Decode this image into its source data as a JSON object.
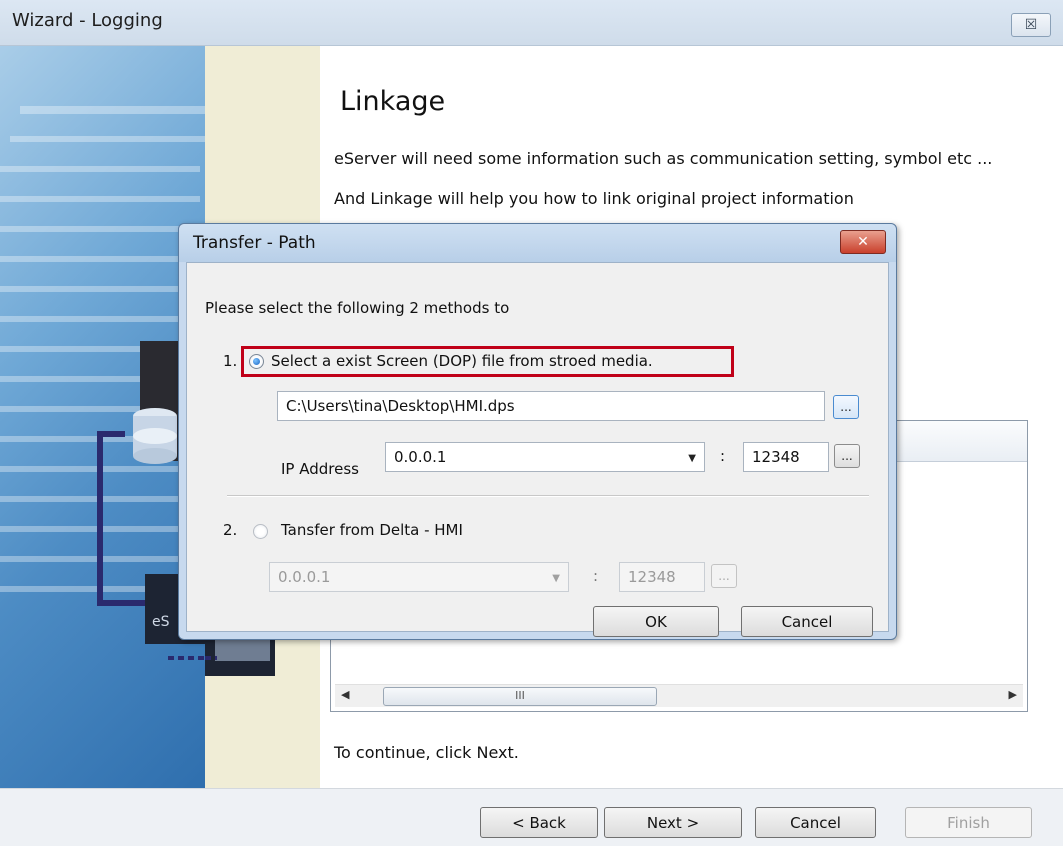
{
  "wizard": {
    "title": "Wizard - Logging",
    "close_symbol": "☒",
    "heading": "Linkage",
    "paragraph1": "eServer will need some information such as communication setting, symbol etc ...",
    "paragraph2": "And Linkage will help you how to link original project information",
    "continue_text": "To continue, click Next.",
    "scroll_thumb_glyph": "III",
    "buttons": {
      "back": "< Back",
      "next": "Next >",
      "cancel": "Cancel",
      "finish": "Finish"
    }
  },
  "dialog": {
    "title": "Transfer - Path",
    "close_symbol": "✕",
    "intro": "Please select the following 2 methods to",
    "option1": {
      "number": "1.",
      "label": "Select a exist  Screen (DOP) file from stroed media.",
      "selected": true,
      "path_value": "C:\\Users\\tina\\Desktop\\HMI.dps",
      "ip_label": "IP Address",
      "ip_value": "0.0.0.1",
      "port_value": "12348"
    },
    "option2": {
      "number": "2.",
      "label": "Tansfer from Delta - HMI",
      "selected": false,
      "ip_value": "0.0.0.1",
      "port_value": "12348"
    },
    "colon": ":",
    "ellipsis": "...",
    "ok_label": "OK",
    "cancel_label": "Cancel"
  },
  "colors": {
    "highlight_border": "#c00018",
    "dialog_frame": "#c7d9ee",
    "close_button": "#c9402c"
  }
}
